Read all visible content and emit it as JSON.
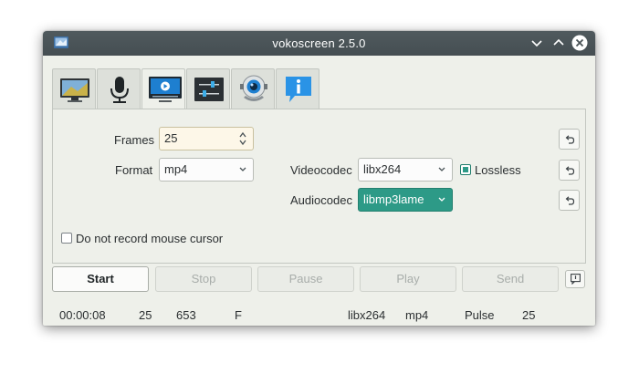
{
  "window": {
    "title": "vokoscreen 2.5.0"
  },
  "tabs": [
    {
      "icon": "monitor-icon",
      "active": false
    },
    {
      "icon": "microphone-icon",
      "active": false
    },
    {
      "icon": "video-player-icon",
      "active": true
    },
    {
      "icon": "sliders-icon",
      "active": false
    },
    {
      "icon": "webcam-icon",
      "active": false
    },
    {
      "icon": "info-icon",
      "active": false
    }
  ],
  "video": {
    "frames_label": "Frames",
    "frames_value": "25",
    "format_label": "Format",
    "format_value": "mp4",
    "videocodec_label": "Videocodec",
    "videocodec_value": "libx264",
    "lossless_label": "Lossless",
    "lossless_checked": true,
    "audiocodec_label": "Audiocodec",
    "audiocodec_value": "libmp3lame",
    "mouse_cursor_label": "Do not record mouse cursor",
    "mouse_cursor_checked": false
  },
  "actions": {
    "start": "Start",
    "stop": "Stop",
    "pause": "Pause",
    "play": "Play",
    "send": "Send"
  },
  "status": {
    "time": "00:00:08",
    "fps": "25",
    "frames": "653",
    "flag": "F",
    "videocodec": "libx264",
    "format": "mp4",
    "audio": "Pulse",
    "fps2": "25"
  },
  "colors": {
    "titlebar": "#4a5357",
    "accent": "#2d9a87",
    "spin_background": "#fdf7e8",
    "window_background": "#eef0ea"
  }
}
